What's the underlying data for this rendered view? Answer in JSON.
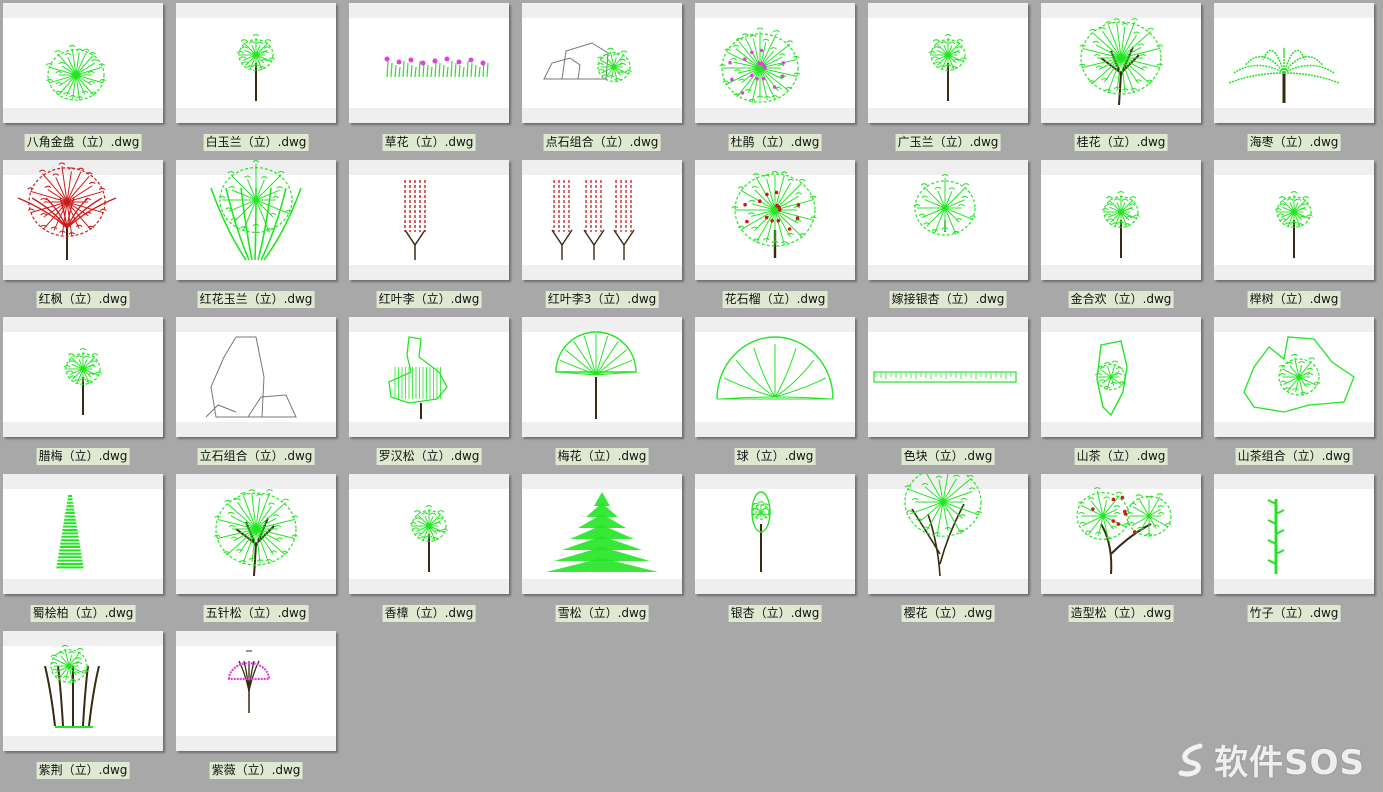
{
  "files": [
    {
      "name": "八角金盘（立）.dwg",
      "icon": "shrub-icon"
    },
    {
      "name": "白玉兰（立）.dwg",
      "icon": "tree-icon"
    },
    {
      "name": "草花（立）.dwg",
      "icon": "flower-bed-icon"
    },
    {
      "name": "点石组合（立）.dwg",
      "icon": "rock-group-icon"
    },
    {
      "name": "杜鹃（立）.dwg",
      "icon": "flowering-shrub-icon"
    },
    {
      "name": "广玉兰（立）.dwg",
      "icon": "tree-icon"
    },
    {
      "name": "桂花（立）.dwg",
      "icon": "broad-tree-icon"
    },
    {
      "name": "海枣（立）.dwg",
      "icon": "palm-icon"
    },
    {
      "name": "红枫（立）.dwg",
      "icon": "red-tree-icon"
    },
    {
      "name": "红花玉兰（立）.dwg",
      "icon": "multi-trunk-tree-icon"
    },
    {
      "name": "红叶李（立）.dwg",
      "icon": "column-tree-icon"
    },
    {
      "name": "红叶李3（立）.dwg",
      "icon": "column-trees-icon"
    },
    {
      "name": "花石榴（立）.dwg",
      "icon": "fruit-tree-icon"
    },
    {
      "name": "嫁接银杏（立）.dwg",
      "icon": "small-tree-icon"
    },
    {
      "name": "金合欢（立）.dwg",
      "icon": "tree-icon"
    },
    {
      "name": "榉树（立）.dwg",
      "icon": "tree-icon"
    },
    {
      "name": "腊梅（立）.dwg",
      "icon": "tree-icon"
    },
    {
      "name": "立石组合（立）.dwg",
      "icon": "standing-rock-icon"
    },
    {
      "name": "罗汉松（立）.dwg",
      "icon": "pine-icon"
    },
    {
      "name": "梅花（立）.dwg",
      "icon": "fan-tree-icon"
    },
    {
      "name": "球（立）.dwg",
      "icon": "ball-shrub-icon"
    },
    {
      "name": "色块（立）.dwg",
      "icon": "hedge-icon"
    },
    {
      "name": "山茶（立）.dwg",
      "icon": "camellia-icon"
    },
    {
      "name": "山茶组合（立）.dwg",
      "icon": "camellia-group-icon"
    },
    {
      "name": "蜀桧柏（立）.dwg",
      "icon": "cypress-icon"
    },
    {
      "name": "五针松（立）.dwg",
      "icon": "broad-tree-icon"
    },
    {
      "name": "香樟（立）.dwg",
      "icon": "tree-icon"
    },
    {
      "name": "雪松（立）.dwg",
      "icon": "cedar-icon"
    },
    {
      "name": "银杏（立）.dwg",
      "icon": "ginkgo-icon"
    },
    {
      "name": "樱花（立）.dwg",
      "icon": "cherry-tree-icon"
    },
    {
      "name": "造型松（立）.dwg",
      "icon": "shaped-pine-icon"
    },
    {
      "name": "竹子（立）.dwg",
      "icon": "bamboo-icon"
    },
    {
      "name": "紫荆（立）.dwg",
      "icon": "redbud-icon"
    },
    {
      "name": "紫薇（立）.dwg",
      "icon": "crape-myrtle-icon"
    }
  ],
  "watermark": "软件SOS",
  "colors": {
    "green": "#22e622",
    "trunk": "#3a2a10",
    "red": "#cc1a1a",
    "magenta": "#e040e0",
    "rock": "#777777"
  }
}
